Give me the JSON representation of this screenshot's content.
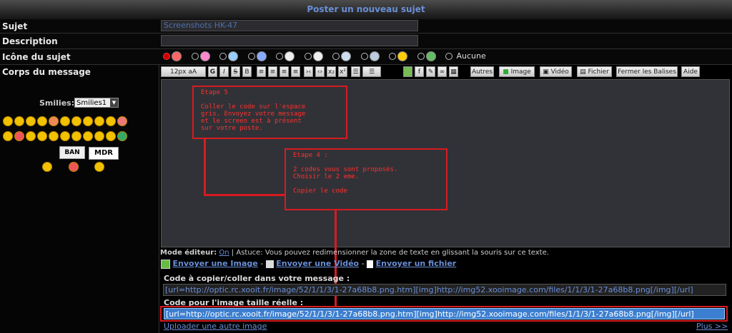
{
  "header": {
    "title": "Poster un nouveau sujet"
  },
  "rows": {
    "subject_label": "Sujet",
    "subject_value": "Screenshots HK-47",
    "description_label": "Description",
    "icon_label": "Icône du sujet",
    "icon_none_label": "Aucune",
    "body_label": "Corps du message"
  },
  "smilies": {
    "label": "Smilies:",
    "select_value": "Smilies1",
    "ban_text": "BAN",
    "mdr_text": "MDR"
  },
  "toolbar": {
    "font_size": "12px",
    "bold": "G",
    "italic": "I",
    "strike": "S",
    "underline": "B",
    "autres": "Autres",
    "image": "Image",
    "video": "Vidéo",
    "fichier": "Fichier",
    "fermer": "Fermer les Balises",
    "aide": "Aide"
  },
  "notes": {
    "etape5": "Etape 5\n\nColler le code sur l'espace\ngris. Envoyez votre message\net le screen est à présent\nsur votre poste.",
    "etape4": "Etape 4 :\n\n2 codes vous sont proposés.\nChoisir le 2 eme.\n\nCopier le code"
  },
  "editor_mode": {
    "label": "Mode éditeur:",
    "value": "On",
    "tip": "| Astuce: Vous pouvez redimensionner la zone de texte en glissant la souris sur ce texte."
  },
  "upload_links": {
    "image": "Envoyer une Image",
    "sep1": "-",
    "video": "Envoyer une Vidéo",
    "sep2": "-",
    "file": "Envoyer un fichier"
  },
  "codes": {
    "copy_label": "Code à copier/coller dans votre message :",
    "copy_value": "[url=http://optic.rc.xooit.fr/image/52/1/1/3/1-27a68b8.png.htm][img]http://img52.xooimage.com/files/1/1/3/1-27a68b8.png[/img][/url]",
    "real_label": "Code pour l'image taille réelle :",
    "real_value": "[url=http://optic.rc.xooit.fr/image/52/1/1/3/1-27a68b8.png.htm][img]http://img52.xooimage.com/files/1/1/3/1-27a68b8.png[/img][/url]"
  },
  "footer": {
    "upload_another": "Uploader une autre image",
    "plus": "Plus >>"
  },
  "colors": {
    "accent": "#6a8fd8",
    "annotation": "#d71b21",
    "background": "#000000"
  }
}
